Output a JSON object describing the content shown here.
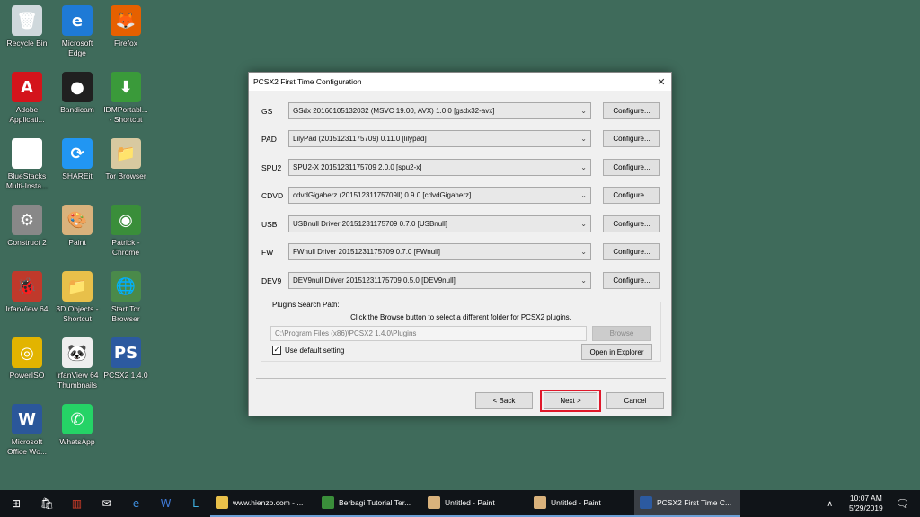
{
  "desktop": {
    "icons": [
      {
        "label": "Recycle Bin",
        "icon": "recycle-bin-icon",
        "color": "#cfd8dc",
        "glyph": "🗑"
      },
      {
        "label": "Microsoft\nEdge",
        "icon": "edge-icon",
        "color": "#1e7ad6",
        "glyph": "e"
      },
      {
        "label": "Firefox",
        "icon": "firefox-icon",
        "color": "#e66000",
        "glyph": "🦊"
      },
      {
        "label": "Adobe\nApplicati...",
        "icon": "adobe-icon",
        "color": "#d4141b",
        "glyph": "A"
      },
      {
        "label": "Bandicam",
        "icon": "bandicam-icon",
        "color": "#202020",
        "glyph": "●"
      },
      {
        "label": "IDMPortabl...\n- Shortcut",
        "icon": "idm-icon",
        "color": "#3a9a3a",
        "glyph": "⬇"
      },
      {
        "label": "BlueStacks\nMulti-Insta...",
        "icon": "file-icon",
        "color": "#ffffff",
        "glyph": ""
      },
      {
        "label": "SHAREit",
        "icon": "shareit-icon",
        "color": "#2196f3",
        "glyph": "⟳"
      },
      {
        "label": "Tor Browser",
        "icon": "tor-icon",
        "color": "#d8c9a0",
        "glyph": "📁"
      },
      {
        "label": "Construct 2",
        "icon": "construct-icon",
        "color": "#888888",
        "glyph": "⚙"
      },
      {
        "label": "Paint",
        "icon": "paint-icon",
        "color": "#d9b27c",
        "glyph": "🎨"
      },
      {
        "label": "Patrick -\nChrome",
        "icon": "chrome-icon",
        "color": "#3a8e3a",
        "glyph": "◉"
      },
      {
        "label": "IrfanView 64",
        "icon": "irfanview-icon",
        "color": "#c0392b",
        "glyph": "🐞"
      },
      {
        "label": "3D Objects -\nShortcut",
        "icon": "folder-icon",
        "color": "#e8c04a",
        "glyph": "📁"
      },
      {
        "label": "Start Tor\nBrowser",
        "icon": "globe-icon",
        "color": "#4a8a4a",
        "glyph": "🌐"
      },
      {
        "label": "PowerISO",
        "icon": "poweriso-icon",
        "color": "#e2b400",
        "glyph": "◎"
      },
      {
        "label": "IrfanView 64\nThumbnails",
        "icon": "panda-icon",
        "color": "#eeeeee",
        "glyph": "🐼"
      },
      {
        "label": "PCSX2 1.4.0",
        "icon": "pcsx2-icon",
        "color": "#2c5aa0",
        "glyph": "PS"
      },
      {
        "label": "Microsoft\nOffice Wo...",
        "icon": "word-icon",
        "color": "#2b579a",
        "glyph": "W"
      },
      {
        "label": "WhatsApp",
        "icon": "whatsapp-icon",
        "color": "#25d366",
        "glyph": "✆"
      }
    ]
  },
  "dialog": {
    "title": "PCSX2 First Time Configuration",
    "close": "✕",
    "configure_label": "Configure...",
    "plugins": [
      {
        "label": "GS",
        "value": "GSdx 20160105132032 (MSVC 19.00, AVX) 1.0.0 [gsdx32-avx]"
      },
      {
        "label": "PAD",
        "value": "LilyPad (20151231175709) 0.11.0 [lilypad]"
      },
      {
        "label": "SPU2",
        "value": "SPU2-X 20151231175709 2.0.0 [spu2-x]"
      },
      {
        "label": "CDVD",
        "value": "cdvdGigaherz (20151231175709ll) 0.9.0 [cdvdGigaherz]"
      },
      {
        "label": "USB",
        "value": "USBnull Driver 20151231175709 0.7.0 [USBnull]"
      },
      {
        "label": "FW",
        "value": "FWnull Driver 20151231175709 0.7.0 [FWnull]"
      },
      {
        "label": "DEV9",
        "value": "DEV9null Driver 20151231175709 0.5.0 [DEV9null]"
      }
    ],
    "search_path": {
      "group_label": "Plugins Search Path:",
      "hint": "Click the Browse button to select a different folder for PCSX2 plugins.",
      "path": "C:\\Program Files (x86)\\PCSX2 1.4.0\\Plugins",
      "browse": "Browse",
      "use_default": "Use default setting",
      "use_default_checked": true,
      "open_explorer": "Open in Explorer"
    },
    "back": "< Back",
    "next": "Next >",
    "cancel": "Cancel",
    "highlight_color": "#e0182a"
  },
  "taskbar": {
    "apps": [
      {
        "label": "www.hienzo.com - ...",
        "icon": "folder-icon",
        "color": "#e8c04a"
      },
      {
        "label": "Berbagi Tutorial Ter...",
        "icon": "chrome-icon",
        "color": "#3a8e3a"
      },
      {
        "label": "Untitled - Paint",
        "icon": "paint-icon",
        "color": "#d9b27c"
      },
      {
        "label": "Untitled - Paint",
        "icon": "paint-icon",
        "color": "#d9b27c"
      },
      {
        "label": "PCSX2 First Time C...",
        "icon": "pcsx2-icon",
        "color": "#2c5aa0"
      }
    ],
    "time": "10:07 AM",
    "date": "5/29/2019"
  }
}
